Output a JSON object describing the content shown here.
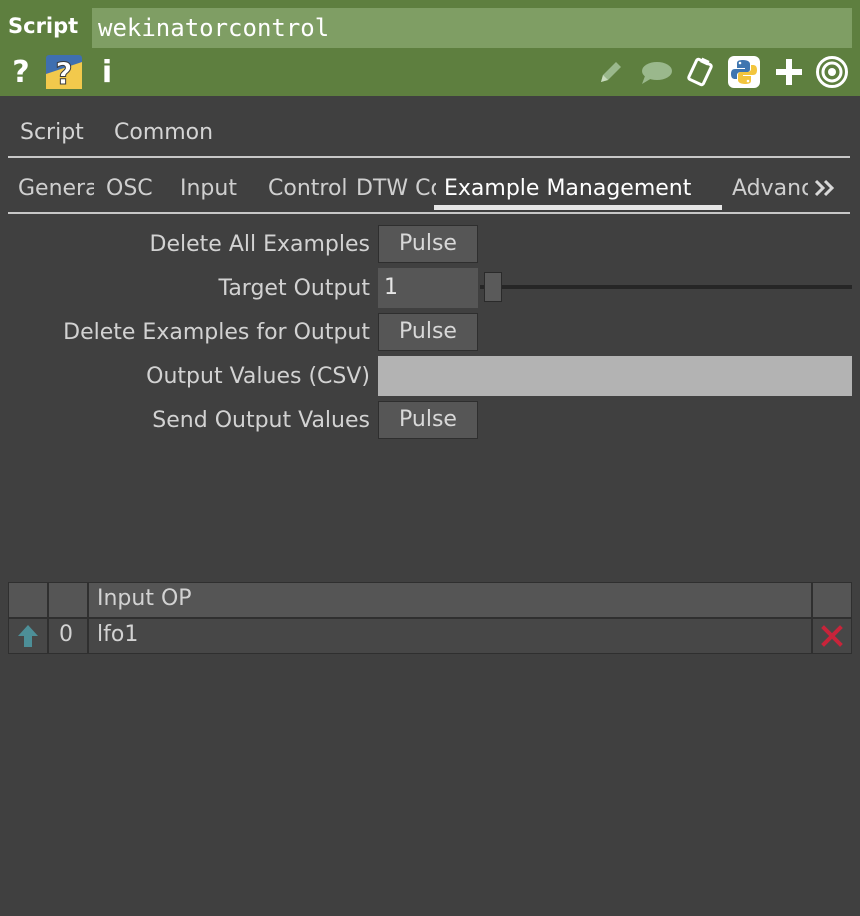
{
  "header": {
    "type_label": "Script",
    "name": "wekinatorcontrol",
    "help_icon": "question-mark-icon",
    "python_help_icon": "python-help-icon",
    "info_icon": "info-icon",
    "right_icons": [
      "pencil-icon",
      "comment-icon",
      "clipboard-icon",
      "python-icon",
      "plus-icon",
      "target-icon"
    ]
  },
  "page_tabs": [
    "Script",
    "Common"
  ],
  "sub_tabs": {
    "items": [
      "General",
      "OSC",
      "Input",
      "Control",
      "DTW Controls",
      "Example Management",
      "Advanced"
    ],
    "active": "Example Management",
    "more_icon": "double-chevron-right-icon"
  },
  "params": {
    "delete_all": {
      "label": "Delete All Examples",
      "button": "Pulse"
    },
    "target_output": {
      "label": "Target Output",
      "value": "1"
    },
    "delete_for_output": {
      "label": "Delete Examples for Output",
      "button": "Pulse"
    },
    "output_values": {
      "label": "Output Values (CSV)",
      "value": ""
    },
    "send_output": {
      "label": "Send Output Values",
      "button": "Pulse"
    }
  },
  "table": {
    "header": [
      "",
      "",
      "Input OP",
      ""
    ],
    "rows": [
      {
        "icon": "arrow-up-icon",
        "index": "0",
        "op": "lfo1",
        "delete_icon": "close-x-icon"
      }
    ]
  },
  "colors": {
    "header_bg": "#5e7f3f",
    "name_field_bg": "#7f9e64",
    "panel_bg": "#404040",
    "delete_red": "#c8243a",
    "arrow_teal": "#4d8f98"
  }
}
